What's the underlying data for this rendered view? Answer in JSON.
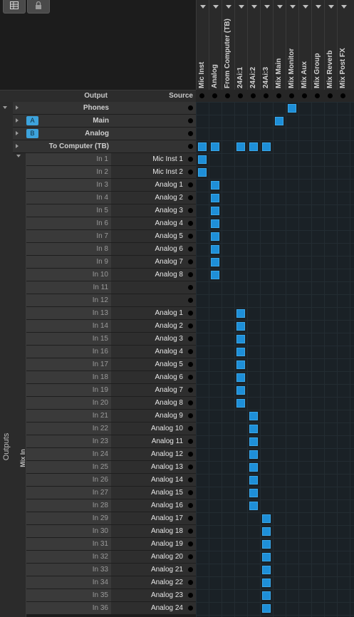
{
  "header": {
    "output_label": "Output",
    "source_label": "Source",
    "columns": [
      "Mic Inst",
      "Analog",
      "From Computer (TB)",
      "24Ai:1",
      "24Ai:2",
      "24Ai:3",
      "Mix Main",
      "Mix Monitor",
      "Mix Aux",
      "Mix Group",
      "Mix Reverb",
      "Mix Post FX"
    ]
  },
  "side": {
    "outputs_label": "Outputs",
    "mix_in_label": "Mix In"
  },
  "top_outputs": [
    {
      "name": "Phones",
      "badge": "",
      "cols": [
        7
      ]
    },
    {
      "name": "Main",
      "badge": "A",
      "cols": [
        6
      ]
    },
    {
      "name": "Analog",
      "badge": "B",
      "cols": []
    },
    {
      "name": "To Computer (TB)",
      "badge": "",
      "cols": [
        0,
        1,
        3,
        4,
        5
      ]
    }
  ],
  "mix_rows": [
    {
      "out": "In 1",
      "src": "Mic Inst 1",
      "col": 0
    },
    {
      "out": "In 2",
      "src": "Mic Inst 2",
      "col": 0
    },
    {
      "out": "In 3",
      "src": "Analog 1",
      "col": 1
    },
    {
      "out": "In 4",
      "src": "Analog 2",
      "col": 1
    },
    {
      "out": "In 5",
      "src": "Analog 3",
      "col": 1
    },
    {
      "out": "In 6",
      "src": "Analog 4",
      "col": 1
    },
    {
      "out": "In 7",
      "src": "Analog 5",
      "col": 1
    },
    {
      "out": "In 8",
      "src": "Analog 6",
      "col": 1
    },
    {
      "out": "In 9",
      "src": "Analog 7",
      "col": 1
    },
    {
      "out": "In 10",
      "src": "Analog 8",
      "col": 1
    },
    {
      "out": "In 11",
      "src": "",
      "col": -1
    },
    {
      "out": "In 12",
      "src": "",
      "col": -1
    },
    {
      "out": "In 13",
      "src": "Analog 1",
      "col": 3
    },
    {
      "out": "In 14",
      "src": "Analog 2",
      "col": 3
    },
    {
      "out": "In 15",
      "src": "Analog 3",
      "col": 3
    },
    {
      "out": "In 16",
      "src": "Analog 4",
      "col": 3
    },
    {
      "out": "In 17",
      "src": "Analog 5",
      "col": 3
    },
    {
      "out": "In 18",
      "src": "Analog 6",
      "col": 3
    },
    {
      "out": "In 19",
      "src": "Analog 7",
      "col": 3
    },
    {
      "out": "In 20",
      "src": "Analog 8",
      "col": 3
    },
    {
      "out": "In 21",
      "src": "Analog 9",
      "col": 4
    },
    {
      "out": "In 22",
      "src": "Analog 10",
      "col": 4
    },
    {
      "out": "In 23",
      "src": "Analog 11",
      "col": 4
    },
    {
      "out": "In 24",
      "src": "Analog 12",
      "col": 4
    },
    {
      "out": "In 25",
      "src": "Analog 13",
      "col": 4
    },
    {
      "out": "In 26",
      "src": "Analog 14",
      "col": 4
    },
    {
      "out": "In 27",
      "src": "Analog 15",
      "col": 4
    },
    {
      "out": "In 28",
      "src": "Analog 16",
      "col": 4
    },
    {
      "out": "In 29",
      "src": "Analog 17",
      "col": 5
    },
    {
      "out": "In 30",
      "src": "Analog 18",
      "col": 5
    },
    {
      "out": "In 31",
      "src": "Analog 19",
      "col": 5
    },
    {
      "out": "In 32",
      "src": "Analog 20",
      "col": 5
    },
    {
      "out": "In 33",
      "src": "Analog 21",
      "col": 5
    },
    {
      "out": "In 34",
      "src": "Analog 22",
      "col": 5
    },
    {
      "out": "In 35",
      "src": "Analog 23",
      "col": 5
    },
    {
      "out": "In 36",
      "src": "Analog 24",
      "col": 5
    }
  ],
  "colors": {
    "accent": "#1e8fd8",
    "badge": "#3da3dc"
  },
  "icons": {
    "toolbar_1": "routing-matrix-icon",
    "toolbar_2": "lock-icon"
  }
}
